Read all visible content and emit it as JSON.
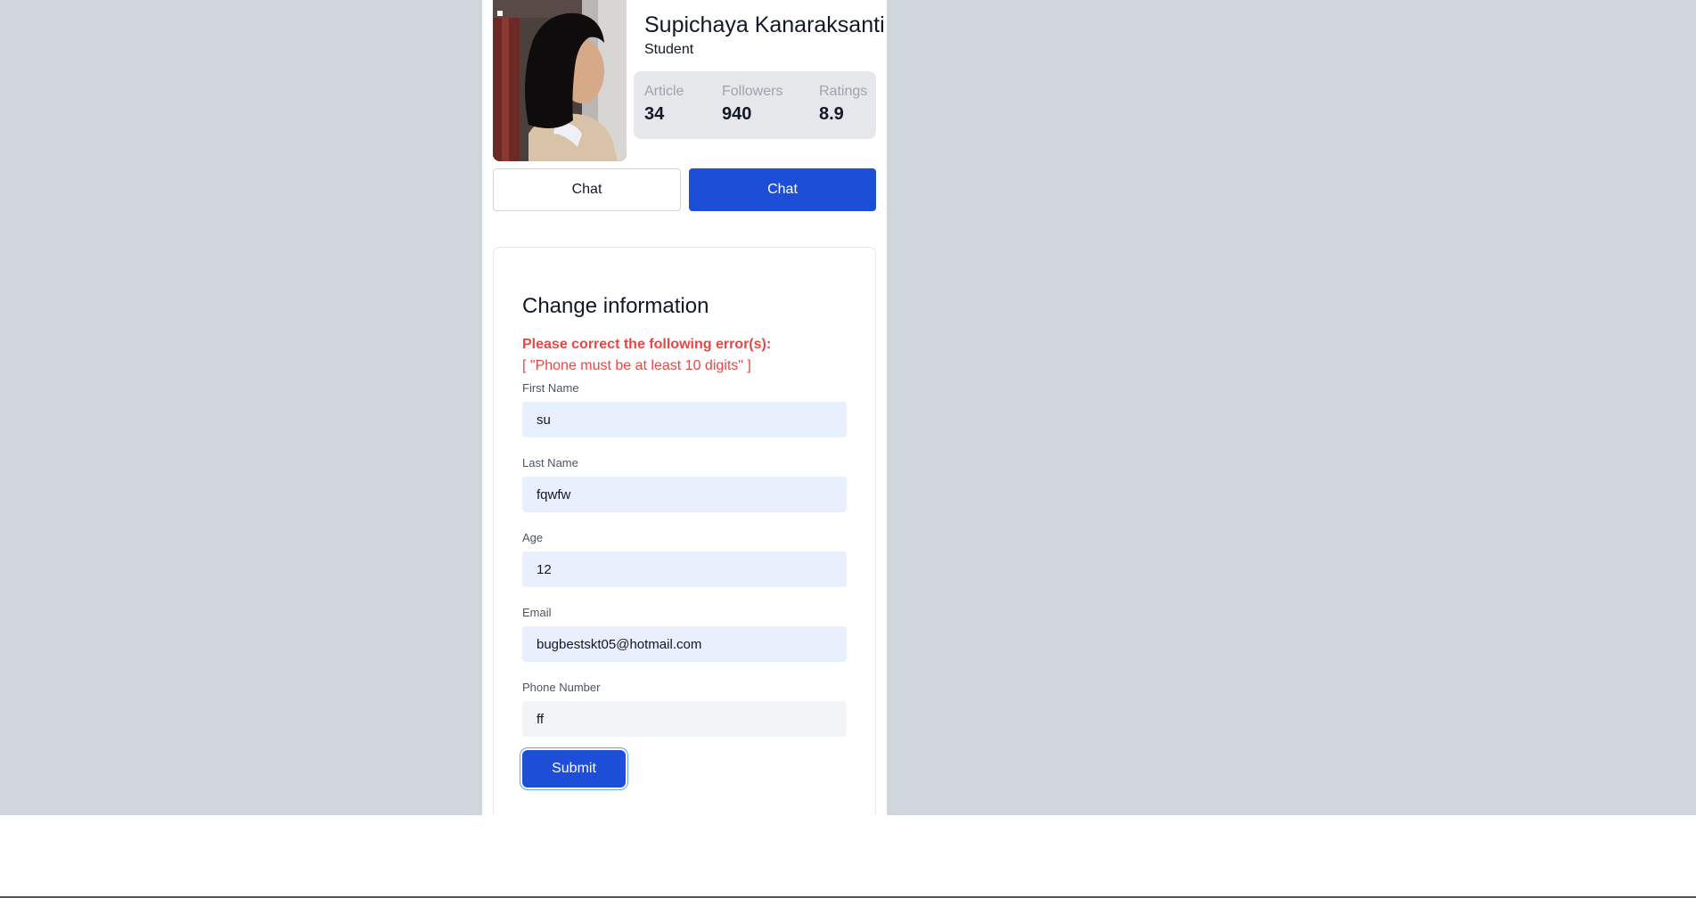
{
  "profile": {
    "name": "Supichaya Kanaraksanti",
    "role": "Student",
    "stats": [
      {
        "label": "Article",
        "value": "34"
      },
      {
        "label": "Followers",
        "value": "940"
      },
      {
        "label": "Ratings",
        "value": "8.9"
      }
    ]
  },
  "actions": {
    "outline_label": "Chat",
    "primary_label": "Chat"
  },
  "form": {
    "title": "Change information",
    "error_heading": "Please correct the following error(s):",
    "error_message": "[ \"Phone must be at least 10 digits\" ]",
    "fields": [
      {
        "label": "First Name",
        "value": "su"
      },
      {
        "label": "Last Name",
        "value": "fqwfw"
      },
      {
        "label": "Age",
        "value": "12"
      },
      {
        "label": "Email",
        "value": "bugbestskt05@hotmail.com"
      },
      {
        "label": "Phone Number",
        "value": "ff"
      }
    ],
    "submit_label": "Submit"
  },
  "colors": {
    "primary": "#1d4ed8",
    "error": "#ef4444",
    "backdrop": "#d1d5dc",
    "autofill": "#e8f0fe"
  }
}
